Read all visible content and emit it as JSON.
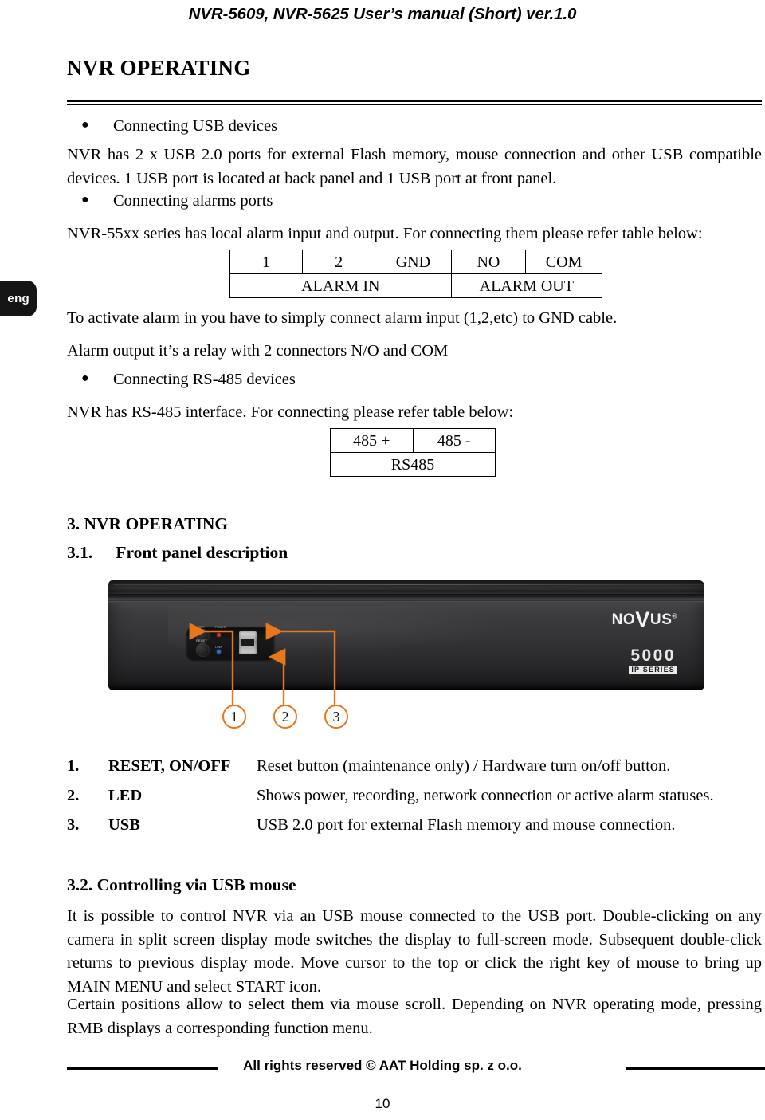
{
  "header": {
    "running_title": "NVR-5609, NVR-5625 User’s manual (Short) ver.1.0"
  },
  "side_tab": {
    "label": "eng"
  },
  "chapter": {
    "title": "NVR OPERATING"
  },
  "bullets": {
    "usb": "Connecting USB devices",
    "alarms": "Connecting alarms ports",
    "rs485": "Connecting RS-485 devices"
  },
  "paragraphs": {
    "usb_body": "NVR has 2 x USB 2.0 ports for external Flash memory, mouse connection and other USB compatible devices. 1 USB port is located at back panel and 1 USB port at front panel.",
    "alarm_intro": "NVR-55xx series has local alarm input and output. For connecting them please refer table below:",
    "alarm_activate": "To activate alarm in you have to simply connect alarm input (1,2,etc) to GND cable.",
    "alarm_relay": "Alarm output it’s a relay with 2 connectors N/O and COM",
    "rs485_intro": "NVR has RS-485 interface. For connecting please refer table below:",
    "mouse_p1": "It is possible to control NVR via an USB mouse connected to the USB port. Double-clicking on any camera in split screen display mode switches the display to full-screen mode. Subsequent double-click returns to previous display mode. Move cursor to the top or click the right key of mouse to bring up MAIN MENU and select START icon.",
    "mouse_p2": "Certain positions allow to select them via mouse scroll. Depending on NVR operating mode, pressing RMB displays a corresponding function menu."
  },
  "alarm_table": {
    "pins": [
      "1",
      "2",
      "GND",
      "NO",
      "COM"
    ],
    "group_in": "ALARM IN",
    "group_out": "ALARM OUT"
  },
  "rs485_table": {
    "pins": [
      "485 +",
      "485 -"
    ],
    "group": "RS485"
  },
  "sections": {
    "s3_num": "3.",
    "s3_title": "NVR OPERATING",
    "s31_num": "3.1.",
    "s31_title": "Front panel description",
    "s32_title": "3.2. Controlling via USB mouse"
  },
  "figure": {
    "brand": "NO",
    "brand_v": "V",
    "brand_rest": "US",
    "brand_reg": "®",
    "series_number": "5000",
    "series_label": "IP SERIES",
    "micro_labels": {
      "top_left": "RESET",
      "top_right": "POWER",
      "reset": "RESET",
      "link": "LINK"
    },
    "callouts": [
      "1",
      "2",
      "3"
    ]
  },
  "front_panel_list": [
    {
      "index": "1.",
      "term": "RESET, ON/OFF",
      "description": "Reset button (maintenance only) / Hardware turn on/off button."
    },
    {
      "index": "2.",
      "term": "LED",
      "description": "Shows power, recording, network connection or active alarm statuses."
    },
    {
      "index": "3.",
      "term": "USB",
      "description": "USB 2.0 port for external Flash memory and mouse connection."
    }
  ],
  "footer": {
    "copyright": "All rights reserved © AAT Holding sp. z o.o.",
    "page_number": "10"
  },
  "colors": {
    "callout_orange": "#e8761c",
    "device_black": "#2e2e30",
    "tab_black": "#151515"
  }
}
